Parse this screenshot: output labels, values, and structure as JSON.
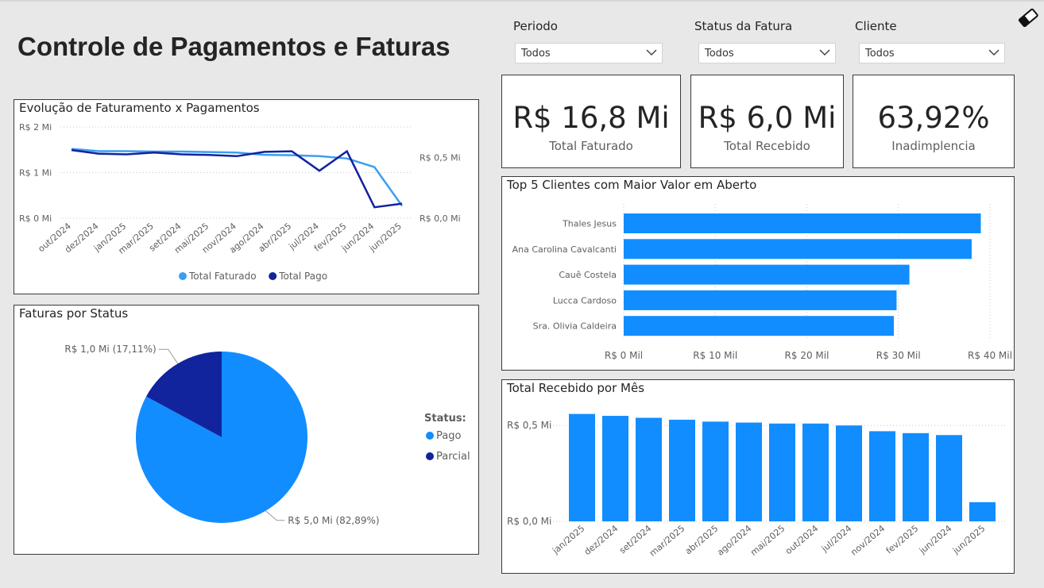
{
  "header": {
    "title": "Controle de Pagamentos e Faturas"
  },
  "filters": [
    {
      "label": "Periodo",
      "value": "Todos"
    },
    {
      "label": "Status da Fatura",
      "value": "Todos"
    },
    {
      "label": "Cliente",
      "value": "Todos"
    }
  ],
  "kpis": [
    {
      "value": "R$ 16,8 Mi",
      "label": "Total Faturado"
    },
    {
      "value": "R$ 6,0 Mi",
      "label": "Total Recebido"
    },
    {
      "value": "63,92%",
      "label": "Inadimplencia"
    }
  ],
  "icons": {
    "clear_filters": "eraser-icon",
    "dropdown": "chevron-down-icon"
  },
  "colors": {
    "light_blue": "#118dff",
    "dark_blue": "#12239e",
    "line_light": "#3a9ff2"
  },
  "chart_data": [
    {
      "id": "evolucao",
      "type": "line",
      "title": "Evolução de Faturamento x Pagamentos",
      "categories": [
        "out/2024",
        "dez/2024",
        "jan/2025",
        "mar/2025",
        "set/2024",
        "mai/2025",
        "nov/2024",
        "ago/2024",
        "abr/2025",
        "jul/2024",
        "fev/2025",
        "jun/2024",
        "jun/2025"
      ],
      "series": [
        {
          "name": "Total Faturado",
          "axis": "left",
          "values": [
            1.52,
            1.47,
            1.47,
            1.46,
            1.46,
            1.45,
            1.44,
            1.39,
            1.38,
            1.36,
            1.31,
            1.12,
            0.27
          ]
        },
        {
          "name": "Total Pago",
          "axis": "right",
          "values": [
            0.56,
            0.53,
            0.525,
            0.54,
            0.525,
            0.52,
            0.51,
            0.545,
            0.55,
            0.39,
            0.55,
            0.09,
            0.12
          ]
        }
      ],
      "y_left_ticks": [
        "R$ 0 Mi",
        "R$ 1 Mi",
        "R$ 2 Mi"
      ],
      "y_right_ticks": [
        "R$ 0,0 Mi",
        "R$ 0,5 Mi"
      ],
      "ylim_left": [
        0,
        2
      ],
      "ylim_right": [
        0,
        0.75
      ],
      "legend": "bottom-center"
    },
    {
      "id": "status",
      "type": "pie",
      "title": "Faturas por Status",
      "legend_title": "Status:",
      "slices": [
        {
          "name": "Pago",
          "value": 5.0,
          "percent": 82.89,
          "label": "R$ 5,0 Mi (82,89%)"
        },
        {
          "name": "Parcial",
          "value": 1.0,
          "percent": 17.11,
          "label": "R$ 1,0 Mi (17,11%)"
        }
      ],
      "legend": "right"
    },
    {
      "id": "top5",
      "type": "bar",
      "orientation": "horizontal",
      "title": "Top 5 Clientes com Maior Valor em Aberto",
      "categories": [
        "Thales Jesus",
        "Ana Carolina Cavalcanti",
        "Cauê Costela",
        "Lucca Cardoso",
        "Sra. Olivia Caldeira"
      ],
      "values": [
        39.0,
        38.0,
        31.2,
        29.8,
        29.5
      ],
      "x_ticks": [
        "R$ 0 Mil",
        "R$ 10 Mil",
        "R$ 20 Mil",
        "R$ 30 Mil",
        "R$ 40 Mil"
      ],
      "xlim": [
        0,
        40
      ]
    },
    {
      "id": "mensal",
      "type": "bar",
      "title": "Total Recebido por Mês",
      "categories": [
        "jan/2025",
        "",
        "dez/2024",
        "",
        "set/2024",
        "",
        "mar/2025",
        "",
        "abr/2025",
        "",
        "ago/2024",
        "",
        "mai/2025",
        "",
        "out/2024",
        "",
        "jul/2024",
        "",
        "nov/2024",
        "",
        "fev/2025",
        "",
        "jun/2024",
        "",
        "jun/2025"
      ],
      "values": [
        0.56,
        0.55,
        0.54,
        0.53,
        0.52,
        0.515,
        0.51,
        0.51,
        0.5,
        0.47,
        0.46,
        0.45,
        0.1
      ],
      "category_labels": [
        "jan/2025",
        "dez/2024",
        "set/2024",
        "mar/2025",
        "abr/2025",
        "ago/2024",
        "mai/2025",
        "out/2024",
        "jul/2024",
        "nov/2024",
        "fev/2025",
        "jun/2024",
        "jun/2025"
      ],
      "y_ticks": [
        "R$ 0,0 Mi",
        "R$ 0,5 Mi"
      ],
      "ylim": [
        0,
        0.6
      ]
    }
  ]
}
